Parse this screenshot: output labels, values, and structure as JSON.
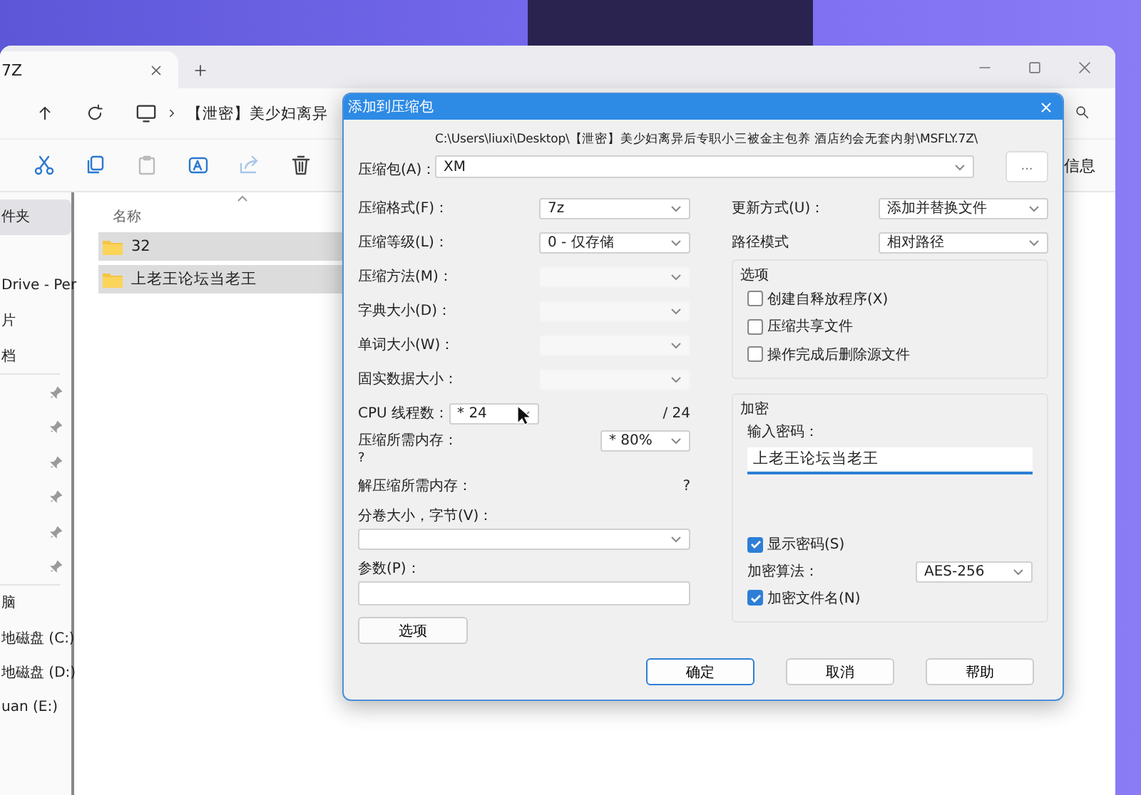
{
  "explorer": {
    "tab": {
      "title": "7Z"
    },
    "breadcrumb": "【泄密】美少妇离异",
    "toolbar": {
      "details_label": "信息"
    },
    "sidebar": {
      "groups": [
        {
          "divider": false,
          "items": [
            {
              "label": "件夹",
              "selected": true,
              "pinned": false
            }
          ]
        },
        {
          "divider": false,
          "items": [
            {
              "label": "Drive - Per",
              "selected": false,
              "pinned": false
            },
            {
              "label": "片",
              "selected": false,
              "pinned": false
            },
            {
              "label": "档",
              "selected": false,
              "pinned": false
            }
          ]
        },
        {
          "divider": true,
          "items": [
            {
              "selected": false,
              "pinned": true
            },
            {
              "selected": false,
              "pinned": true
            },
            {
              "selected": false,
              "pinned": true
            },
            {
              "selected": false,
              "pinned": true
            },
            {
              "selected": false,
              "pinned": true
            },
            {
              "selected": false,
              "pinned": true
            }
          ]
        },
        {
          "divider": true,
          "items": [
            {
              "label": "脑",
              "selected": false,
              "pinned": false
            },
            {
              "label": "地磁盘 (C:)",
              "selected": false,
              "pinned": false
            },
            {
              "label": "地磁盘 (D:)",
              "selected": false,
              "pinned": false
            },
            {
              "label": "uan (E:)",
              "selected": false,
              "pinned": false
            }
          ]
        }
      ]
    },
    "files": {
      "columns": [
        "名称"
      ],
      "rows": [
        {
          "name": "32",
          "selected": true
        },
        {
          "name": "上老王论坛当老王",
          "selected": true
        }
      ]
    }
  },
  "dialog": {
    "title": "添加到压缩包",
    "archive": {
      "label": "压缩包(A)：",
      "path": "C:\\Users\\liuxi\\Desktop\\【泄密】美少妇离异后专职小三被金主包养 酒店约会无套内射\\MSFLY.7Z\\",
      "value": "XM",
      "browse": "..."
    },
    "left": [
      {
        "kind": "select",
        "label": "压缩格式(F)：",
        "value": "7z",
        "disabled": false
      },
      {
        "kind": "select",
        "label": "压缩等级(L)：",
        "value": "0 - 仅存储",
        "disabled": false
      },
      {
        "kind": "select",
        "label": "压缩方法(M)：",
        "disabled": true
      },
      {
        "kind": "select",
        "label": "字典大小(D)：",
        "disabled": true
      },
      {
        "kind": "select",
        "label": "单词大小(W)：",
        "disabled": true
      },
      {
        "kind": "select",
        "label": "固实数据大小：",
        "disabled": true
      },
      {
        "kind": "threads",
        "label": "CPU 线程数：",
        "value": "* 24",
        "note": "/ 24",
        "disabled": false
      },
      {
        "kind": "memory",
        "label": "压缩所需内存：",
        "note": "?",
        "value": "* 80%",
        "disabled": false
      },
      {
        "kind": "info",
        "label": "解压缩所需内存：",
        "note": "?"
      }
    ],
    "split": {
      "label": "分卷大小，字节(V)："
    },
    "params": {
      "label": "参数(P)："
    },
    "options_button": "选项",
    "right": [
      {
        "label": "更新方式(U)：",
        "value": "添加并替换文件"
      },
      {
        "label": "路径模式",
        "value": "相对路径"
      }
    ],
    "options": {
      "title": "选项",
      "items": [
        {
          "label": "创建自释放程序(X)",
          "checked": false
        },
        {
          "label": "压缩共享文件",
          "checked": false
        },
        {
          "label": "操作完成后删除源文件",
          "checked": false
        }
      ]
    },
    "encryption": {
      "title": "加密",
      "password_label": "输入密码：",
      "password": "上老王论坛当老王",
      "show_password": {
        "label": "显示密码(S)",
        "checked": true
      },
      "method_label": "加密算法：",
      "method": "AES-256",
      "encrypt_names": {
        "label": "加密文件名(N)",
        "checked": true
      }
    },
    "buttons": [
      {
        "label": "确定",
        "default": true
      },
      {
        "label": "取消",
        "default": false
      },
      {
        "label": "帮助",
        "default": false
      }
    ]
  }
}
